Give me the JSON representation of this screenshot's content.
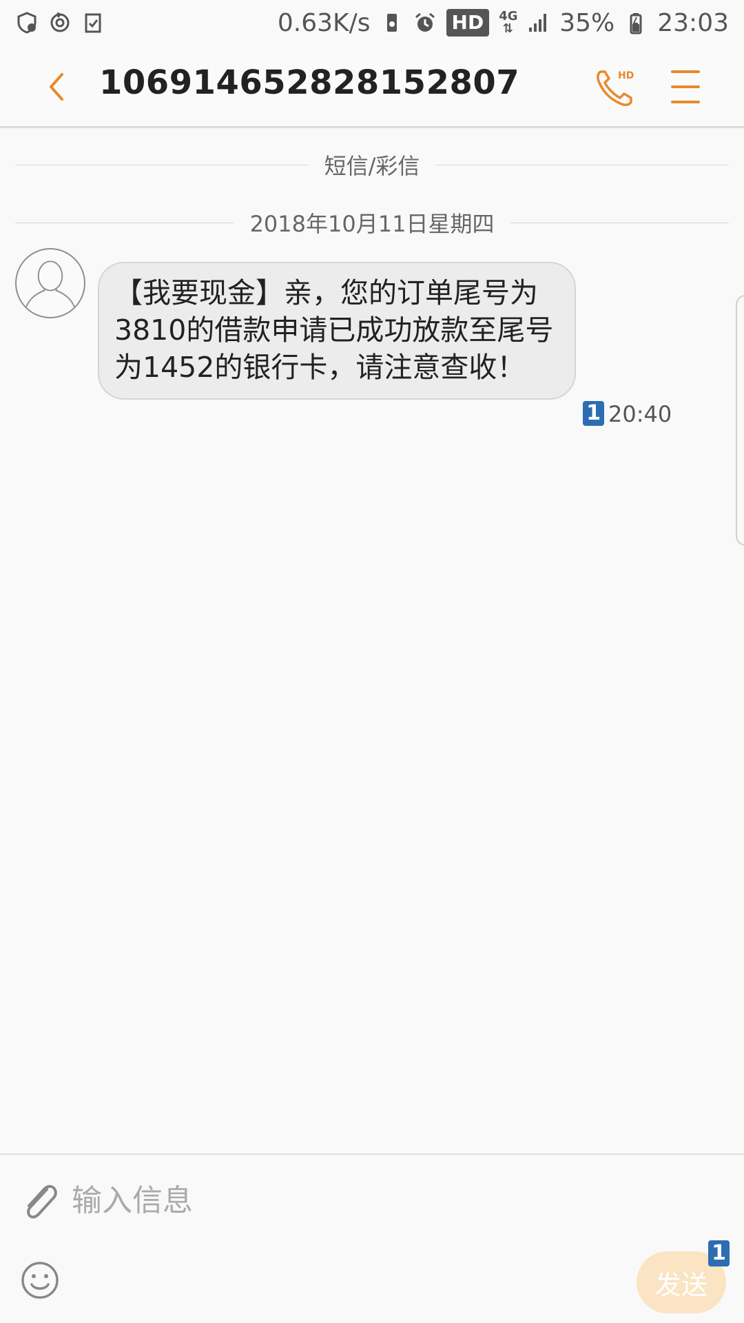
{
  "status_bar": {
    "network_speed": "0.63K/s",
    "hd_label": "HD",
    "network_type": "4G",
    "battery": "35%",
    "time": "23:03"
  },
  "header": {
    "title": "106914652828152807",
    "call_badge": "HD",
    "accent_color": "#e8892b"
  },
  "conversation": {
    "type_label": "短信/彩信",
    "date_label": "2018年10月11日星期四",
    "messages": [
      {
        "text": "【我要现金】亲，您的订单尾号为3810的借款申请已成功放款至尾号为1452的银行卡，请注意查收！",
        "sim": "1",
        "time": "20:40"
      }
    ]
  },
  "composer": {
    "placeholder": "输入信息",
    "send_label": "发送",
    "send_sim": "1"
  }
}
